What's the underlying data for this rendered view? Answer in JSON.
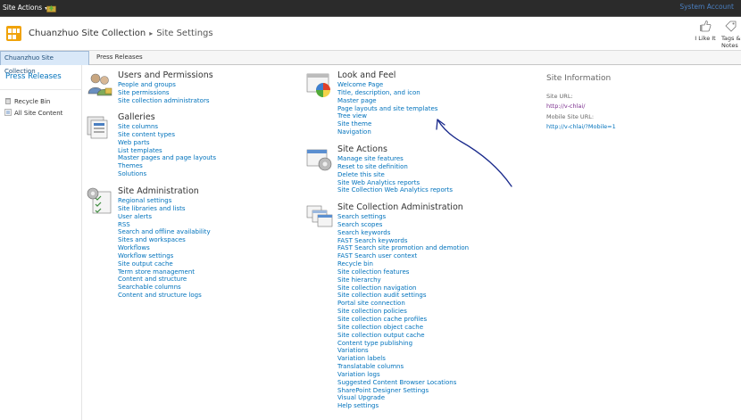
{
  "topbar": {
    "site_actions": "Site Actions",
    "system_account": "System Account"
  },
  "title": {
    "site_name": "Chuanzhuo Site Collection",
    "separator": "▸",
    "page": "Site Settings",
    "i_like_it": "I Like It",
    "tags_notes": "Tags &\nNotes"
  },
  "tabs": [
    {
      "label": "Chuanzhuo Site Collection"
    },
    {
      "label": "Press Releases"
    }
  ],
  "leftnav": {
    "heading": "Press Releases",
    "items": [
      {
        "label": "Recycle Bin",
        "icon": "recycle-bin-icon"
      },
      {
        "label": "All Site Content",
        "icon": "all-site-content-icon"
      }
    ]
  },
  "sections": {
    "users": {
      "title": "Users and Permissions",
      "links": [
        "People and groups",
        "Site permissions",
        "Site collection administrators"
      ]
    },
    "galleries": {
      "title": "Galleries",
      "links": [
        "Site columns",
        "Site content types",
        "Web parts",
        "List templates",
        "Master pages and page layouts",
        "Themes",
        "Solutions"
      ]
    },
    "admin": {
      "title": "Site Administration",
      "links": [
        "Regional settings",
        "Site libraries and lists",
        "User alerts",
        "RSS",
        "Search and offline availability",
        "Sites and workspaces",
        "Workflows",
        "Workflow settings",
        "Site output cache",
        "Term store management",
        "Content and structure",
        "Searchable columns",
        "Content and structure logs"
      ]
    },
    "look": {
      "title": "Look and Feel",
      "links": [
        "Welcome Page",
        "Title, description, and icon",
        "Master page",
        "Page layouts and site templates",
        "Tree view",
        "Site theme",
        "Navigation"
      ]
    },
    "actions": {
      "title": "Site Actions",
      "links": [
        "Manage site features",
        "Reset to site definition",
        "Delete this site",
        "Site Web Analytics reports",
        "Site Collection Web Analytics reports"
      ]
    },
    "collection": {
      "title": "Site Collection Administration",
      "links": [
        "Search settings",
        "Search scopes",
        "Search keywords",
        "FAST Search keywords",
        "FAST Search site promotion and demotion",
        "FAST Search user context",
        "Recycle bin",
        "Site collection features",
        "Site hierarchy",
        "Site collection navigation",
        "Site collection audit settings",
        "Portal site connection",
        "Site collection policies",
        "Site collection cache profiles",
        "Site collection object cache",
        "Site collection output cache",
        "Content type publishing",
        "Variations",
        "Variation labels",
        "Translatable columns",
        "Variation logs",
        "Suggested Content Browser Locations",
        "SharePoint Designer Settings",
        "Visual Upgrade",
        "Help settings"
      ]
    }
  },
  "info": {
    "heading": "Site Information",
    "site_url_label": "Site URL:",
    "site_url": "http://v-chlai/",
    "mobile_url_label": "Mobile Site URL:",
    "mobile_url": "http://v-chlai/?Mobile=1"
  },
  "colors": {
    "link": "#0072bc",
    "topbar": "#2b2b2b",
    "logo": "#f0a30a",
    "arrow": "#1a2a8c"
  }
}
